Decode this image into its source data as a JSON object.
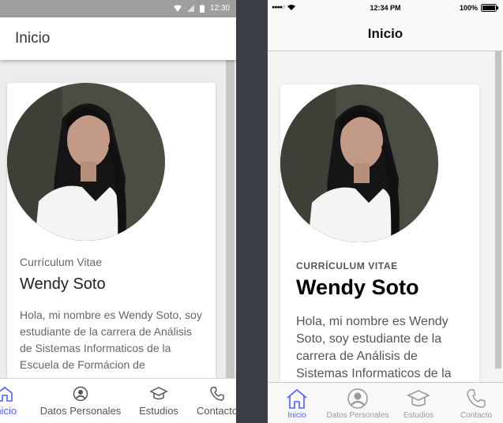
{
  "colors": {
    "accent": "#4f5dff",
    "background": "#3b3d47",
    "android_status_bar": "#9e9e9e",
    "ios_bar": "#f8f8f8"
  },
  "android": {
    "status": {
      "time": "12:30",
      "icons": [
        "wifi-icon",
        "signal-icon",
        "battery-icon"
      ]
    },
    "toolbar": {
      "title": "Inicio"
    },
    "card": {
      "subtitle": "Currículum Vitae",
      "name": "Wendy Soto",
      "bio": "Hola, mi nombre es Wendy Soto, soy estudiante de la carrera de Análisis de Sistemas Informaticos de la Escuela de Formácion de"
    },
    "tabs": [
      {
        "label": "Inicio",
        "icon": "home-icon",
        "active": true
      },
      {
        "label": "Datos Personales",
        "icon": "person-icon",
        "active": false
      },
      {
        "label": "Estudios",
        "icon": "graduation-cap-icon",
        "active": false
      },
      {
        "label": "Contacto",
        "icon": "phone-icon",
        "active": false
      }
    ]
  },
  "ios": {
    "status": {
      "carrier_signal": "●●●●○",
      "time": "12:34 PM",
      "battery": "100%"
    },
    "navbar": {
      "title": "Inicio"
    },
    "card": {
      "subtitle": "CURRÍCULUM VITAE",
      "name": "Wendy Soto",
      "bio": "Hola, mi nombre es Wendy Soto, soy estudiante de la carrera de Análisis de Sistemas Informaticos de la"
    },
    "tabs": [
      {
        "label": "Inicio",
        "icon": "home-icon",
        "active": true
      },
      {
        "label": "Datos Personales",
        "icon": "person-icon",
        "active": false
      },
      {
        "label": "Estudios",
        "icon": "graduation-cap-icon",
        "active": false
      },
      {
        "label": "Contacto",
        "icon": "phone-icon",
        "active": false
      }
    ]
  }
}
